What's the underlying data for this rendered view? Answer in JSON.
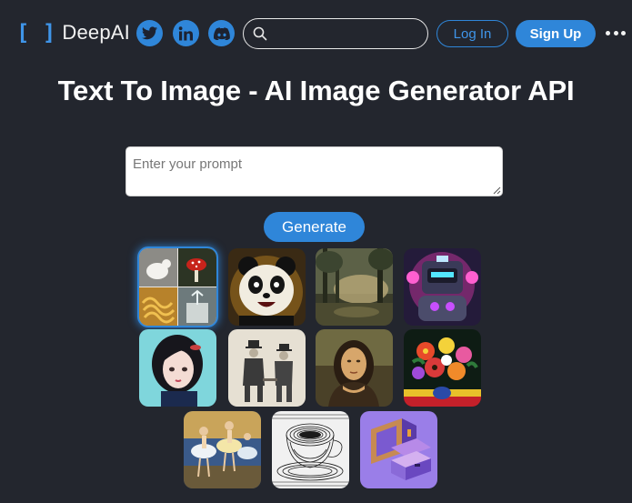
{
  "header": {
    "logo_text": "DeepAI",
    "social": [
      {
        "name": "twitter",
        "icon": "twitter-bird-icon"
      },
      {
        "name": "linkedin",
        "icon": "linkedin-in-icon",
        "text": "in"
      },
      {
        "name": "discord",
        "icon": "discord-logo-icon"
      }
    ],
    "search": {
      "placeholder": "",
      "value": "",
      "icon": "search-icon"
    },
    "login_label": "Log In",
    "signup_label": "Sign Up",
    "more_icon": "more-horizontal-icon"
  },
  "title": "Text To Image - AI Image Generator API",
  "prompt": {
    "placeholder": "Enter your prompt",
    "value": ""
  },
  "generate_label": "Generate",
  "gallery": [
    {
      "subject": "collage: white fox, red mushroom, pasta, fountain",
      "selected": true
    },
    {
      "subject": "cartoon panda"
    },
    {
      "subject": "misty forest landscape"
    },
    {
      "subject": "neon robot"
    },
    {
      "subject": "anime girl portrait"
    },
    {
      "subject": "vintage sketch of two men"
    },
    {
      "subject": "renaissance portrait"
    },
    {
      "subject": "colorful flower bouquet"
    },
    {
      "subject": "impressionist ballet dancers"
    },
    {
      "subject": "engraved teacup"
    },
    {
      "subject": "isometric purple retro computer"
    }
  ],
  "colors": {
    "background": "#23262e",
    "accent": "#2f86d9",
    "accent_text": "#3f95e9",
    "text": "#ffffff"
  }
}
